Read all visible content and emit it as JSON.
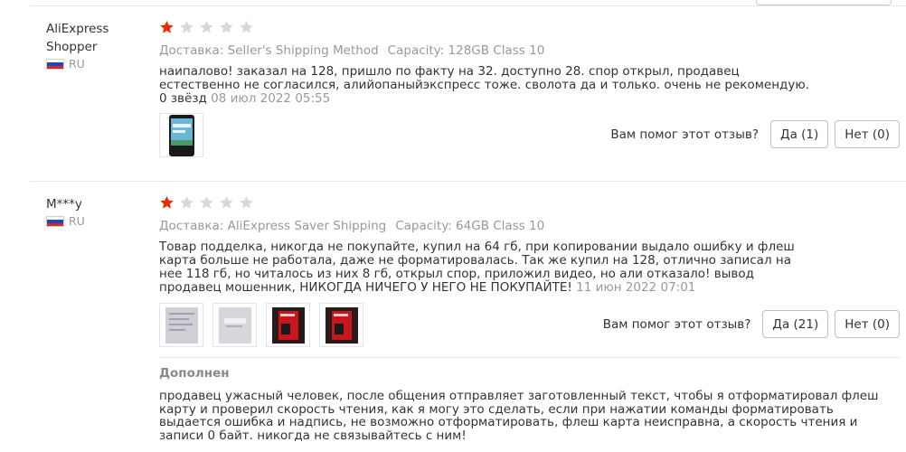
{
  "colors": {
    "star_active": "#e62e04",
    "star_inactive": "#d8d8d8",
    "muted_text": "#999999",
    "separator": "#e8e8e8"
  },
  "helpful_label": "Вам помог этот отзыв?",
  "reviews": [
    {
      "user_name": "AliExpress Shopper",
      "country": "RU",
      "rating": 1,
      "rating_max": 5,
      "delivery": "Доставка: Seller's Shipping Method",
      "capacity": "Capacity: 128GB Class 10",
      "text": "наипалово! заказал на 128, пришло по факту на 32. доступно 28. спор открыл, продавец естественно не согласился, алийопаныйэкспресс тоже. сволота да и только. очень не рекомендую. 0 звёзд",
      "date": "08 июл 2022 05:55",
      "photos": [
        "phone-screenshot-icon"
      ],
      "yes_label": "Да (1)",
      "no_label": "Нет (0)"
    },
    {
      "user_name": "M***y",
      "country": "RU",
      "rating": 1,
      "rating_max": 5,
      "delivery": "Доставка: AliExpress Saver Shipping",
      "capacity": "Capacity: 64GB Class 10",
      "text": "Товар подделка, никогда не покупайте, купил на 64 гб, при копировании выдало ошибку и флеш карта больше не работала, даже не форматировалась. Так же купил на 128, отлично записал на нее 118 гб, но читалось из них 8 гб, открыл спор, приложил видео, но али отказало! вывод продавец мошенник, НИКОГДА НИЧЕГО У НЕГО НЕ ПОКУПАЙТЕ!",
      "date": "11 июн 2022 07:01",
      "photos": [
        "document-photo-icon",
        "card-package-photo-icon",
        "red-sd-card-photo-icon",
        "red-sd-card-photo-icon"
      ],
      "yes_label": "Да (21)",
      "no_label": "Нет (0)",
      "append_title": "Дополнен",
      "append_text": "продавец ужасный человек, после общения отправляет заготовленный текст, чтобы я отформатировал флеш карту и проверил скорость чтения, как я могу это сделать, если при нажатии команды форматировать выдается ошибка и надпись, не возможно отформатировать, флеш карта неисправна, а скорость чтения и записи 0 байт. никогда не связывайтесь с ним!"
    }
  ]
}
